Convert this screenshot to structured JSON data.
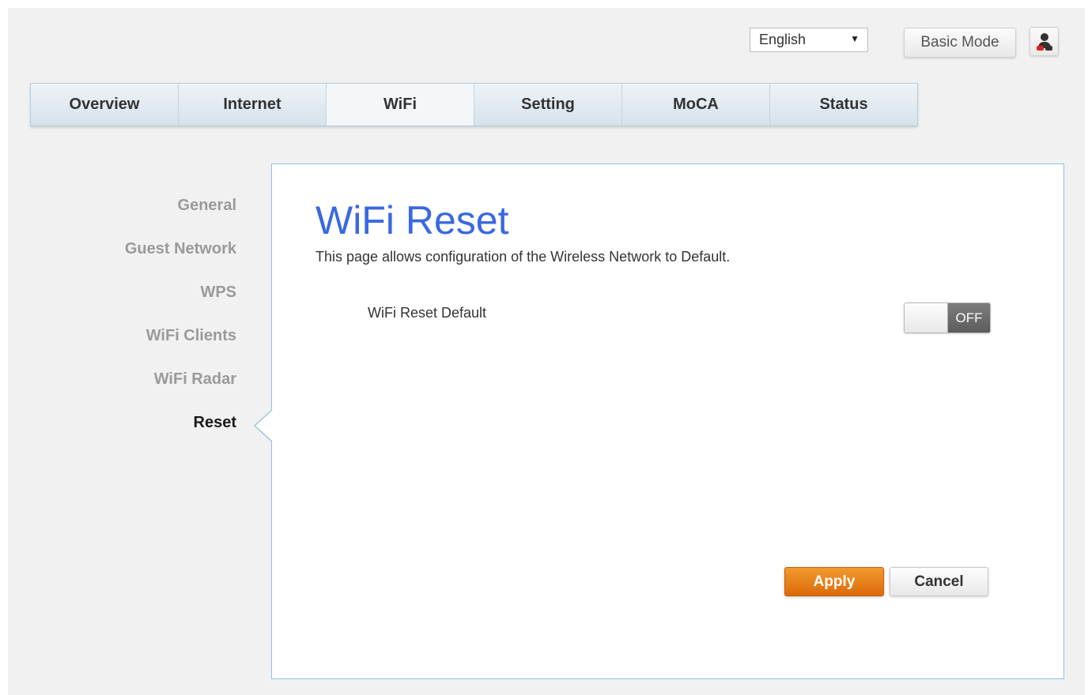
{
  "header": {
    "language": {
      "selected": "English"
    },
    "basic_mode_label": "Basic Mode",
    "user_icon": "user-icon"
  },
  "nav": {
    "tabs": [
      {
        "label": "Overview",
        "active": false
      },
      {
        "label": "Internet",
        "active": false
      },
      {
        "label": "WiFi",
        "active": true
      },
      {
        "label": "Setting",
        "active": false
      },
      {
        "label": "MoCA",
        "active": false
      },
      {
        "label": "Status",
        "active": false
      }
    ]
  },
  "sidebar": {
    "items": [
      {
        "label": "General",
        "active": false
      },
      {
        "label": "Guest Network",
        "active": false
      },
      {
        "label": "WPS",
        "active": false
      },
      {
        "label": "WiFi Clients",
        "active": false
      },
      {
        "label": "WiFi Radar",
        "active": false
      },
      {
        "label": "Reset",
        "active": true
      }
    ]
  },
  "main": {
    "title": "WiFi Reset",
    "description": "This page allows configuration of the Wireless Network to Default.",
    "reset_default": {
      "label": "WiFi Reset Default",
      "state": "OFF"
    },
    "apply_label": "Apply",
    "cancel_label": "Cancel"
  },
  "colors": {
    "title": "#3a68e0",
    "apply": "#e47a12",
    "panel_border": "#8fc3dc",
    "active_text": "#1a1a1a",
    "inactive_text": "#9a9a9a"
  }
}
